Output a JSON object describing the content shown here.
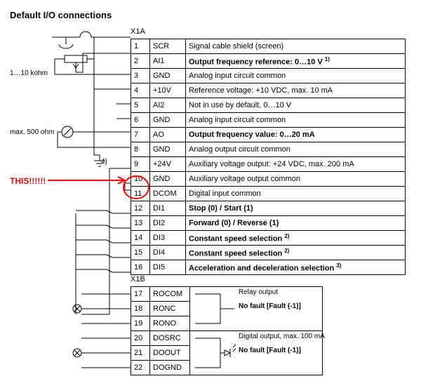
{
  "title": "Default I/O connections",
  "blockA_label": "X1A",
  "blockB_label": "X1B",
  "annotation": "THIS!!!!!!",
  "left_labels": {
    "pot": "1…10 kohm",
    "ohm": "max. 500 ohm",
    "four": "4)"
  },
  "relay_label": "Relay output",
  "relay_text": "No fault [Fault (-1)]",
  "digout_label": "Digital output, max. 100 mA",
  "digout_text": "No fault [Fault (-1)]",
  "rowsA": [
    {
      "n": "1",
      "s": "SCR",
      "d": "Signal cable shield (screen)",
      "b": false
    },
    {
      "n": "2",
      "s": "AI1",
      "d": "Output frequency reference: 0…10 V <sup>1)</sup>",
      "b": true
    },
    {
      "n": "3",
      "s": "GND",
      "d": "Analog input circuit common",
      "b": false
    },
    {
      "n": "4",
      "s": "+10V",
      "d": "Reference voltage: +10 VDC, max. 10 mA",
      "b": false
    },
    {
      "n": "5",
      "s": "AI2",
      "d": "Not in use by default. 0…10 V",
      "b": false
    },
    {
      "n": "6",
      "s": "GND",
      "d": "Analog input circuit common",
      "b": false
    },
    {
      "n": "7",
      "s": "AO",
      "d": "Output frequency value: 0…20 mA",
      "b": true
    },
    {
      "n": "8",
      "s": "GND",
      "d": "Analog output circuit common",
      "b": false
    },
    {
      "n": "9",
      "s": "+24V",
      "d": "Auxiliary voltage output: +24 VDC, max. 200 mA",
      "b": false
    },
    {
      "n": "10",
      "s": "GND",
      "d": "Auxiliary voltage output common",
      "b": false
    },
    {
      "n": "11",
      "s": "DCOM",
      "d": "Digital input common",
      "b": false
    },
    {
      "n": "12",
      "s": "DI1",
      "d": "Stop (0) / Start (1)",
      "b": true
    },
    {
      "n": "13",
      "s": "DI2",
      "d": "Forward (0) / Reverse (1)",
      "b": true
    },
    {
      "n": "14",
      "s": "DI3",
      "d": "Constant speed selection <sup>2)</sup>",
      "b": true
    },
    {
      "n": "15",
      "s": "DI4",
      "d": "Constant speed selection <sup>2)</sup>",
      "b": true
    },
    {
      "n": "16",
      "s": "DI5",
      "d": "Acceleration and deceleration selection <sup>3)</sup>",
      "b": true
    }
  ],
  "rowsB": [
    {
      "n": "17",
      "s": "ROCOM"
    },
    {
      "n": "18",
      "s": "RONC"
    },
    {
      "n": "19",
      "s": "RONO"
    },
    {
      "n": "20",
      "s": "DOSRC"
    },
    {
      "n": "21",
      "s": "DOOUT"
    },
    {
      "n": "22",
      "s": "DOGND"
    }
  ]
}
